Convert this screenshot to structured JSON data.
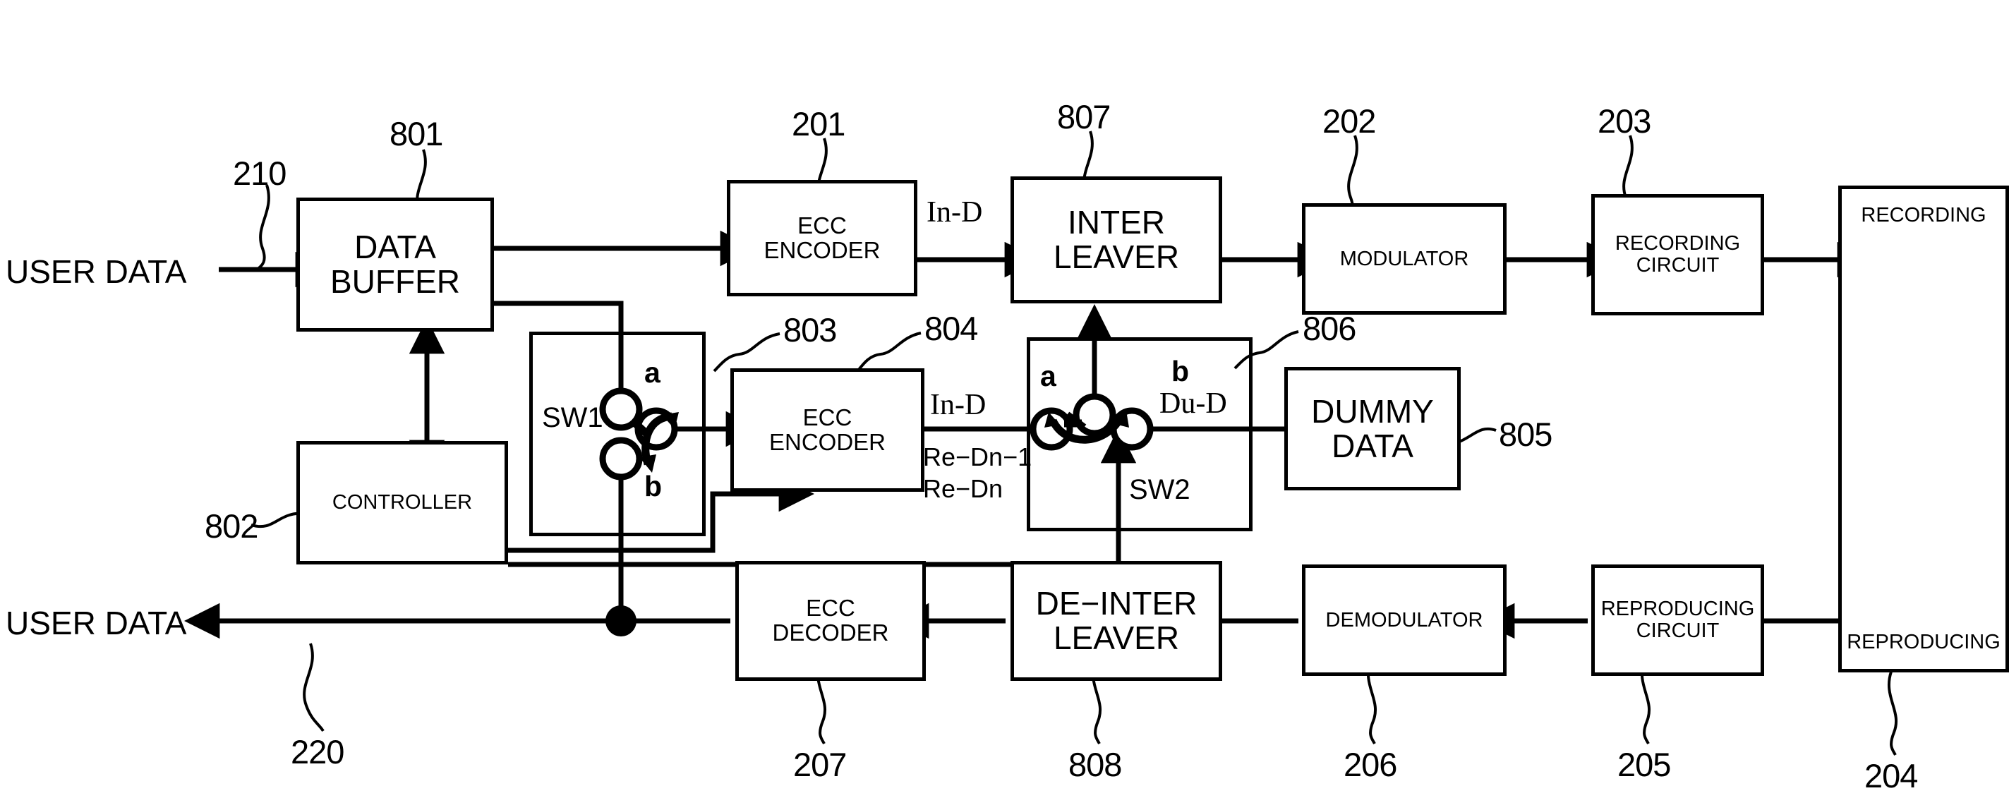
{
  "figure": {
    "title": "Recording and reproducing apparatus block diagram",
    "io": {
      "input_label": "USER DATA",
      "output_label": "USER DATA"
    },
    "blocks": {
      "data_buffer": {
        "line1": "DATA",
        "line2": "BUFFER"
      },
      "controller": {
        "line1": "CONTROLLER"
      },
      "ecc_encoder_main": {
        "line1": "ECC",
        "line2": "ENCODER"
      },
      "ecc_encoder_sub": {
        "line1": "ECC",
        "line2": "ENCODER"
      },
      "interleaver": {
        "line1": "INTER",
        "line2": "LEAVER"
      },
      "modulator": {
        "line1": "MODULATOR"
      },
      "recording_circuit": {
        "line1": "RECORDING",
        "line2": "CIRCUIT"
      },
      "dummy_data": {
        "line1": "DUMMY",
        "line2": "DATA"
      },
      "medium": {
        "top": "RECORDING",
        "bottom": "REPRODUCING"
      },
      "reproducing_circuit": {
        "line1": "REPRODUCING",
        "line2": "CIRCUIT"
      },
      "demodulator": {
        "line1": "DEMODULATOR"
      },
      "deinterleaver": {
        "line1": "DE−INTER",
        "line2": "LEAVER"
      },
      "ecc_decoder": {
        "line1": "ECC",
        "line2": "DECODER"
      }
    },
    "switches": {
      "sw1": {
        "name": "SW1",
        "terminal_a": "a",
        "terminal_b": "b"
      },
      "sw2": {
        "name": "SW2",
        "terminal_a": "a",
        "terminal_b": "b"
      }
    },
    "signal_labels": {
      "in_d_top": "In-D",
      "in_d_mid": "In-D",
      "re_dn_1": "Re−Dn−1",
      "re_dn": "Re−Dn",
      "du_d": "Du-D"
    },
    "reference_numerals": {
      "r210": "210",
      "r801": "801",
      "r201": "201",
      "r807": "807",
      "r202": "202",
      "r203": "203",
      "r803": "803",
      "r804": "804",
      "r806": "806",
      "r805": "805",
      "r802": "802",
      "r220": "220",
      "r207": "207",
      "r808": "808",
      "r206": "206",
      "r205": "205",
      "r204": "204"
    },
    "colors": {
      "stroke": "#000000",
      "background": "#ffffff"
    }
  }
}
